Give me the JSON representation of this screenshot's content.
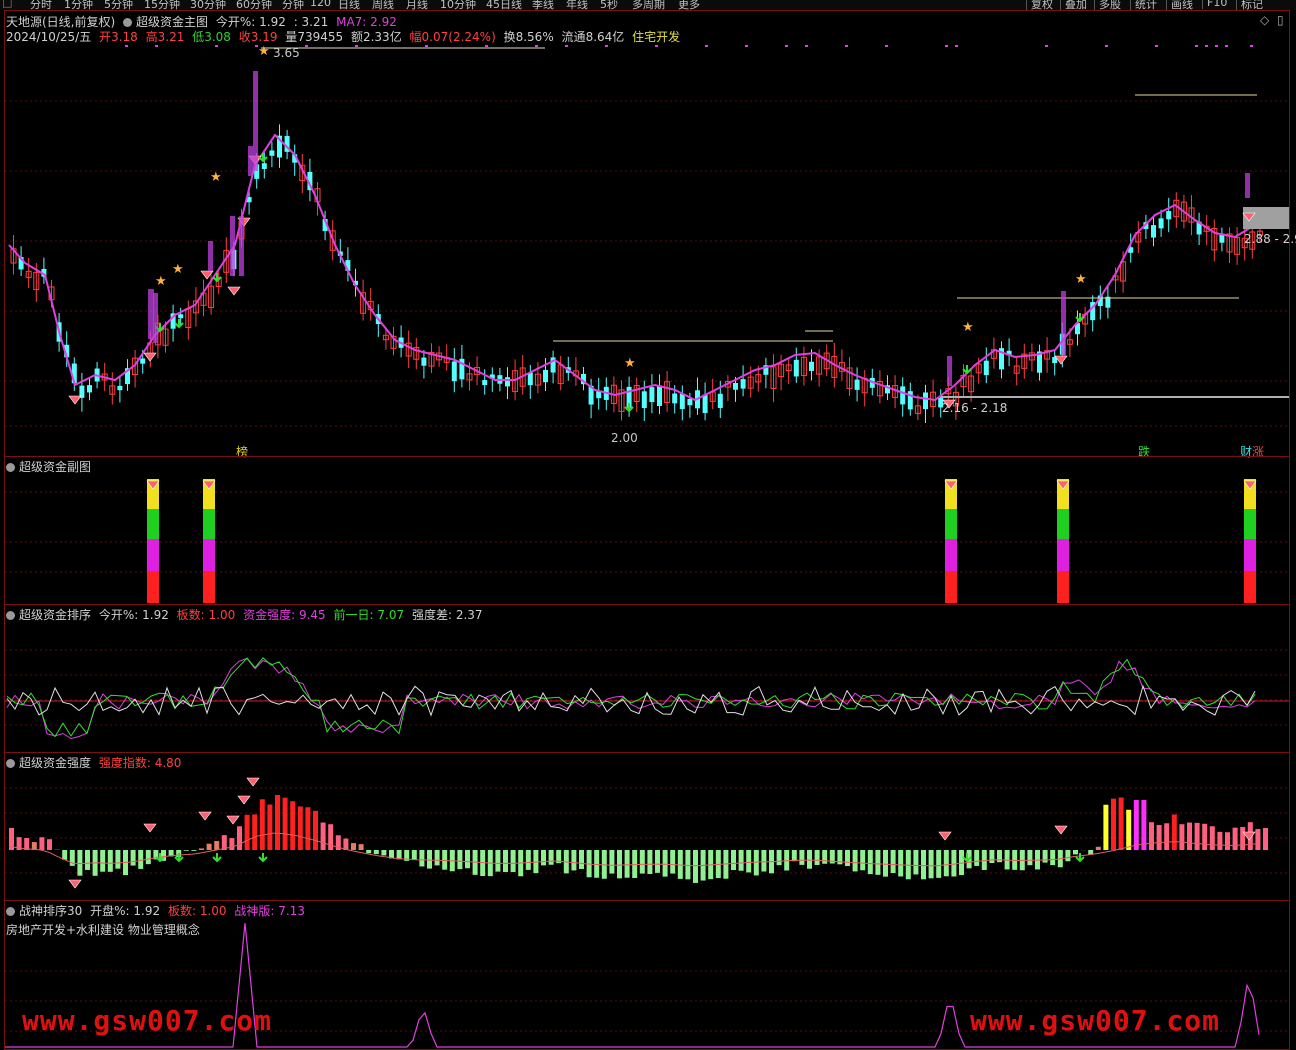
{
  "toolbar": {
    "tabs": [
      "分时",
      "1分钟",
      "5分钟",
      "15分钟",
      "30分钟",
      "60分钟",
      "分钟",
      "120",
      "日线",
      "周线",
      "月线",
      "10分钟",
      "45日线",
      "季线",
      "年线",
      "5秒",
      "多周期",
      "更多"
    ],
    "right_buttons": [
      "复权",
      "叠加",
      "多股",
      "统计",
      "画线",
      "F10",
      "标记"
    ]
  },
  "main": {
    "stock_name": "天地源(日线,前复权)",
    "indicator_name": "超级资金主图",
    "open_pct_label": "今开%:",
    "open_pct_value": "1.92",
    "open_pct_value2": ": 3.21",
    "ma_label": "MA7: 2.92",
    "date": "2024/10/25/五",
    "open_label": "开",
    "open_value": "3.18",
    "high_label": "高",
    "high_value": "3.21",
    "low_label": "低",
    "low_value": "3.08",
    "close_label": "收",
    "close_value": "3.19",
    "volume_label": "量",
    "volume_value": "739455",
    "amount_label": "额",
    "amount_value": "2.33亿",
    "change_label": "幅",
    "change_value": "0.07(2.24%)",
    "turnover_label": "换",
    "turnover_value": "8.56%",
    "float_label": "流通",
    "float_value": "8.64亿",
    "sector": "住宅开发",
    "price_high_label": "3.65",
    "price_low_label": "2.00",
    "range_label_mid": "2.16 - 2.18",
    "range_label_right": "2.88 - 2.9",
    "tag_bang": "榜",
    "tag_die": "跌",
    "tag_cai": "财",
    "tag_zhang": "涨"
  },
  "sub1": {
    "title": "超级资金副图"
  },
  "sub2": {
    "title": "超级资金排序",
    "open_label": "今开%:",
    "open_value": "1.92",
    "board_label": "板数:",
    "board_value": "1.00",
    "strength_label": "资金强度:",
    "strength_value": "9.45",
    "prev_label": "前一日:",
    "prev_value": "7.07",
    "diff_label": "强度差:",
    "diff_value": "2.37"
  },
  "sub3": {
    "title": "超级资金强度",
    "index_label": "强度指数:",
    "index_value": "4.80"
  },
  "sub4": {
    "title": "战神排序30",
    "open_label": "开盘%:",
    "open_value": "1.92",
    "board_label": "板数:",
    "board_value": "1.00",
    "god_label": "战神版:",
    "god_value": "7.13",
    "concepts": "房地产开发+水利建设 物业管理概念"
  },
  "watermark": "www.gsw007.com",
  "colors": {
    "up": "#ff4040",
    "down": "#54ffff",
    "ma": "#e040e0",
    "border": "#7a1111",
    "label_gray": "#c8c8c8"
  }
}
